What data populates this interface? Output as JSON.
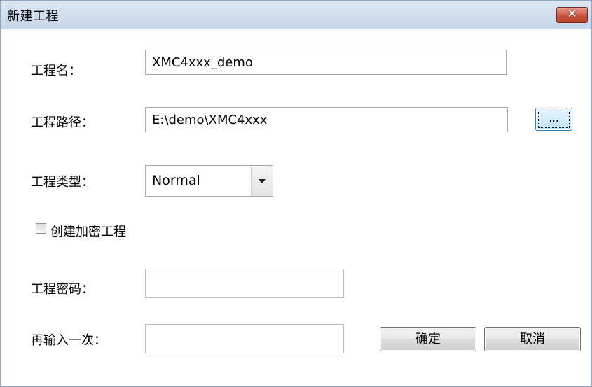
{
  "window": {
    "title": "新建工程",
    "close_symbol": "✕"
  },
  "form": {
    "project_name_label": "工程名：",
    "project_name_value": "XMC4xxx_demo",
    "project_path_label": "工程路径：",
    "project_path_value": "E:\\demo\\XMC4xxx",
    "browse_label": "...",
    "project_type_label": "工程类型：",
    "project_type_value": "Normal",
    "encrypt_label": "创建加密工程",
    "encrypt_checked": false,
    "password_label": "工程密码：",
    "password_value": "",
    "confirm_password_label": "再输入一次：",
    "confirm_password_value": ""
  },
  "buttons": {
    "ok_label": "确定",
    "cancel_label": "取消"
  },
  "icons": {
    "close": "close-icon",
    "dropdown": "chevron-down-icon"
  }
}
